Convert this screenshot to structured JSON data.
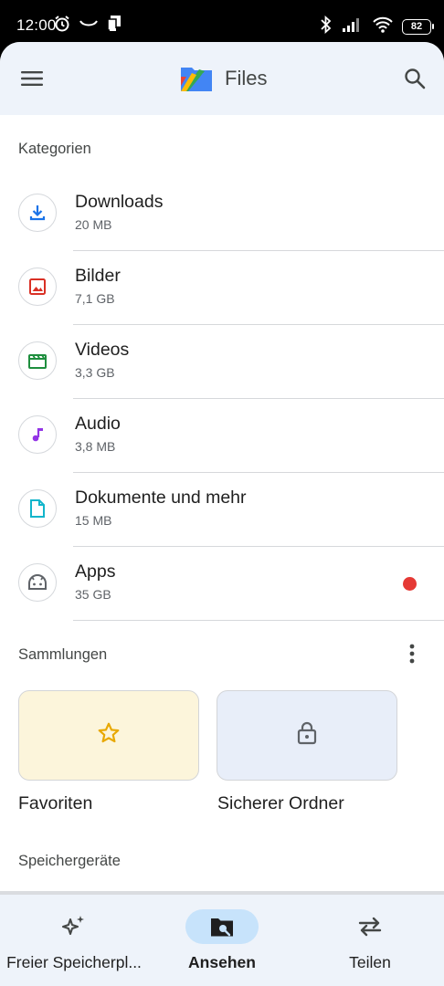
{
  "status_bar": {
    "time": "12:00",
    "battery": "82"
  },
  "app_bar": {
    "title": "Files",
    "menu_icon": "hamburger-menu-icon",
    "search_icon": "search-icon"
  },
  "categories_section": {
    "header": "Kategorien",
    "items": [
      {
        "name": "Downloads",
        "size": "20 MB",
        "icon": "download-icon",
        "color": "#1a73e8"
      },
      {
        "name": "Bilder",
        "size": "7,1 GB",
        "icon": "image-icon",
        "color": "#d93025"
      },
      {
        "name": "Videos",
        "size": "3,3 GB",
        "icon": "video-clapper-icon",
        "color": "#1e8e3e"
      },
      {
        "name": "Audio",
        "size": "3,8 MB",
        "icon": "music-note-icon",
        "color": "#9334e6"
      },
      {
        "name": "Dokumente und mehr",
        "size": "15 MB",
        "icon": "document-icon",
        "color": "#12b5cb"
      },
      {
        "name": "Apps",
        "size": "35 GB",
        "icon": "android-icon",
        "color": "#5f6368",
        "badge": true
      }
    ]
  },
  "collections_section": {
    "header": "Sammlungen",
    "items": [
      {
        "label": "Favoriten",
        "icon": "star-icon",
        "color": "#e8a800"
      },
      {
        "label": "Sicherer Ordner",
        "icon": "lock-icon",
        "color": "#5f6368"
      }
    ]
  },
  "storage_section": {
    "header": "Speichergeräte"
  },
  "bottom_nav": {
    "items": [
      {
        "label": "Freier Speicherpl...",
        "icon": "sparkle-icon",
        "active": false
      },
      {
        "label": "Ansehen",
        "icon": "folder-search-icon",
        "active": true
      },
      {
        "label": "Teilen",
        "icon": "swap-arrows-icon",
        "active": false
      }
    ]
  },
  "colors": {
    "app_bar_bg": "#eef3fa",
    "active_nav_pill": "#c7e3fb",
    "badge_red": "#e53935",
    "favorites_card": "#fcf5db",
    "safe_folder_card": "#e8eef9"
  }
}
